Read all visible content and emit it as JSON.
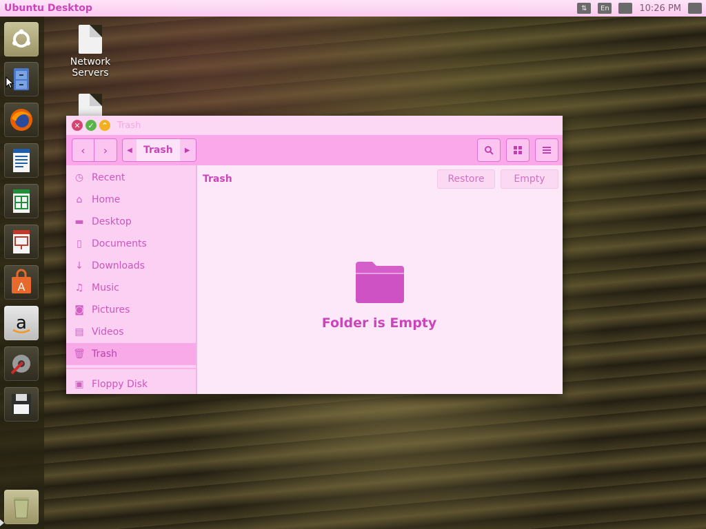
{
  "top_panel": {
    "title": "Ubuntu Desktop",
    "language": "En",
    "clock": "10:26 PM"
  },
  "launcher": {
    "items": [
      {
        "name": "ubuntu-dash"
      },
      {
        "name": "files"
      },
      {
        "name": "firefox"
      },
      {
        "name": "writer"
      },
      {
        "name": "calc"
      },
      {
        "name": "impress"
      },
      {
        "name": "software-center"
      },
      {
        "name": "amazon"
      },
      {
        "name": "system-settings"
      },
      {
        "name": "floppy"
      },
      {
        "name": "trash"
      }
    ]
  },
  "desktop": {
    "icons": [
      {
        "label": "Network\nServers"
      }
    ]
  },
  "window": {
    "title": "Trash",
    "breadcrumb": "Trash",
    "content_title": "Trash",
    "restore_label": "Restore",
    "empty_label": "Empty",
    "empty_message": "Folder is Empty",
    "sidebar": [
      {
        "label": "Recent",
        "icon": "clock-icon"
      },
      {
        "label": "Home",
        "icon": "home-icon"
      },
      {
        "label": "Desktop",
        "icon": "folder-icon"
      },
      {
        "label": "Documents",
        "icon": "document-icon"
      },
      {
        "label": "Downloads",
        "icon": "download-icon"
      },
      {
        "label": "Music",
        "icon": "music-icon"
      },
      {
        "label": "Pictures",
        "icon": "camera-icon"
      },
      {
        "label": "Videos",
        "icon": "film-icon"
      },
      {
        "label": "Trash",
        "icon": "trash-icon"
      },
      {
        "label": "Floppy Disk",
        "icon": "floppy-icon"
      }
    ]
  },
  "colors": {
    "accent": "#cc44bb",
    "toolbar": "#fba8ea",
    "window_bg": "#fde8fa"
  }
}
